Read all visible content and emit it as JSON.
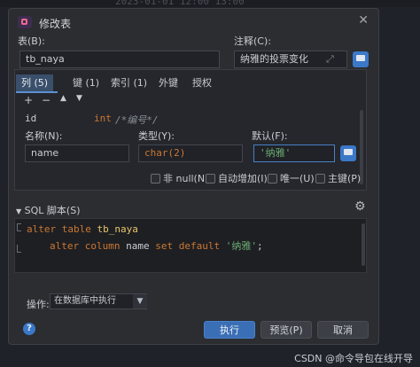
{
  "dialog": {
    "title": "修改表",
    "table_label": "表(B):",
    "table_value": "tb_naya",
    "comment_label": "注释(C):",
    "comment_value": "纳雅的投票变化"
  },
  "tabs": [
    {
      "label": "列 (5)",
      "active": true
    },
    {
      "label": "键 (1)",
      "active": false
    },
    {
      "label": "索引 (1)",
      "active": false
    },
    {
      "label": "外键",
      "active": false
    },
    {
      "label": "授权",
      "active": false
    }
  ],
  "toolbar": {
    "add": "+",
    "remove": "−",
    "up": "▲",
    "down": "▼"
  },
  "column_preview": {
    "name": "id",
    "type": "int",
    "comment": "/*编号*/"
  },
  "column_form": {
    "name_label": "名称(N):",
    "name_value": "name",
    "type_label": "类型(Y):",
    "type_value": "char(2)",
    "default_label": "默认(F):",
    "default_value": "'纳雅'"
  },
  "checkboxes": [
    {
      "label": "非 null(N)",
      "checked": false
    },
    {
      "label": "自动增加(I)",
      "checked": false
    },
    {
      "label": "唯一(U)",
      "checked": false
    },
    {
      "label": "主键(P)",
      "checked": false
    }
  ],
  "sql": {
    "header": "SQL 脚本(S)",
    "line1_keyword": "alter table",
    "line1_ident": "tb_naya",
    "line2_keyword": "alter column",
    "line2_col": "name",
    "line2_keyword2": "set default",
    "line2_str": "'纳雅'",
    "line2_end": ";"
  },
  "operation": {
    "label": "操作:",
    "selected": "在数据库中执行"
  },
  "buttons": {
    "help": "?",
    "execute": "执行",
    "preview": "预览(P)",
    "cancel": "取消"
  },
  "background": {
    "ghost_text": "2023-01-01 12:00 13:00"
  },
  "footer": {
    "watermark": "CSDN @命令导包在线开导"
  },
  "colors": {
    "accent": "#3b6fb5",
    "keyword": "#cc7832",
    "string": "#6aab73",
    "identifier": "#e8c46a"
  }
}
